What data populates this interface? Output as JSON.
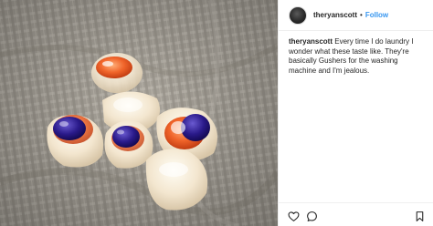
{
  "post": {
    "username": "theryanscott",
    "separator": "•",
    "follow_label": "Follow",
    "caption_user": "theryanscott",
    "caption_text": "Every time I do laundry I wonder what these taste like. They're basically Gushers for the washing machine and I'm jealous."
  },
  "icons": {
    "like": "heart-icon",
    "comment": "comment-icon",
    "save": "bookmark-icon"
  },
  "colors": {
    "link_blue": "#3897f0",
    "text": "#262626",
    "divider": "#efefef"
  }
}
